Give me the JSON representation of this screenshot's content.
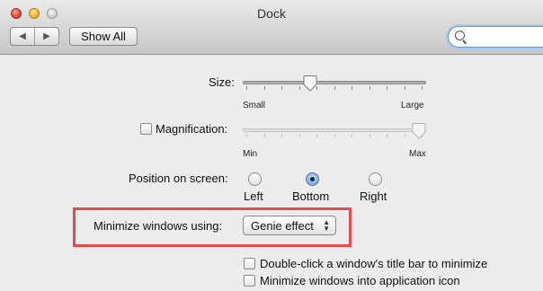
{
  "window": {
    "title": "Dock"
  },
  "toolbar": {
    "back_icon": "back-triangle-icon",
    "forward_icon": "forward-triangle-icon",
    "show_all_label": "Show All",
    "search_placeholder": ""
  },
  "settings": {
    "size": {
      "label": "Size:",
      "min_label": "Small",
      "max_label": "Large",
      "value_fraction": 0.37
    },
    "magnification": {
      "label": "Magnification:",
      "checked": false,
      "min_label": "Min",
      "max_label": "Max",
      "value_fraction": 0.96
    },
    "position": {
      "label": "Position on screen:",
      "options": [
        {
          "label": "Left",
          "selected": false
        },
        {
          "label": "Bottom",
          "selected": true
        },
        {
          "label": "Right",
          "selected": false
        }
      ]
    },
    "minimize": {
      "label": "Minimize windows using:",
      "selected": "Genie effect"
    },
    "checkboxes": [
      {
        "label": "Double-click a window's title bar to minimize",
        "checked": false
      },
      {
        "label": "Minimize windows into application icon",
        "checked": false
      }
    ]
  },
  "colors": {
    "highlight_box": "#e64b4b",
    "selected_radio": "#7fa9e0"
  }
}
